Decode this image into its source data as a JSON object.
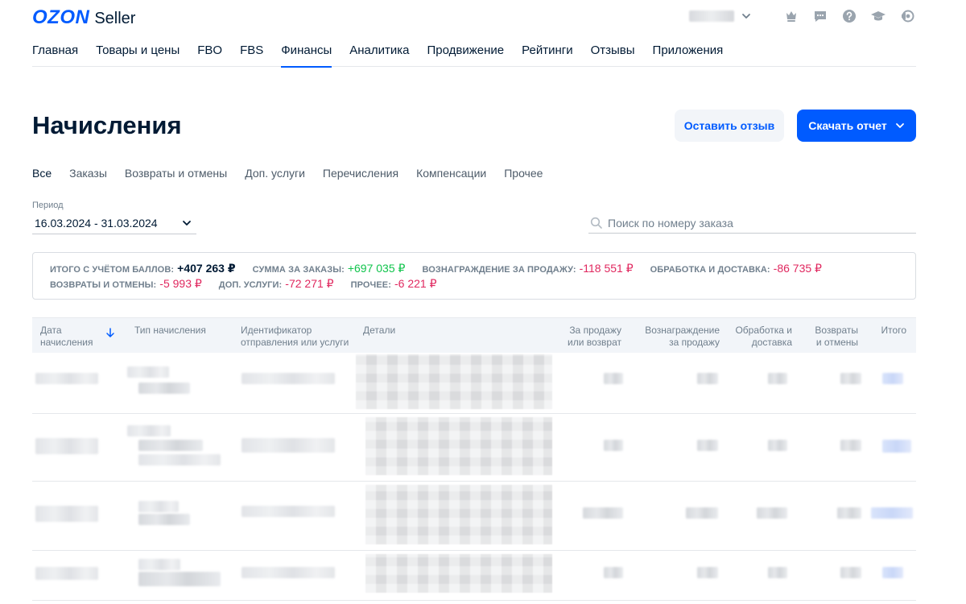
{
  "header": {
    "logo_brand": "OZON",
    "logo_product": "Seller",
    "icons": [
      "crown-icon",
      "chat-icon",
      "help-icon",
      "graduation-cap-icon",
      "megaphone-icon"
    ]
  },
  "nav": {
    "items": [
      {
        "label": "Главная",
        "active": false
      },
      {
        "label": "Товары и цены",
        "active": false
      },
      {
        "label": "FBO",
        "active": false
      },
      {
        "label": "FBS",
        "active": false
      },
      {
        "label": "Финансы",
        "active": true
      },
      {
        "label": "Аналитика",
        "active": false
      },
      {
        "label": "Продвижение",
        "active": false
      },
      {
        "label": "Рейтинги",
        "active": false
      },
      {
        "label": "Отзывы",
        "active": false
      },
      {
        "label": "Приложения",
        "active": false
      }
    ]
  },
  "page": {
    "title": "Начисления",
    "feedback_button": "Оставить отзыв",
    "report_button": "Скачать отчет"
  },
  "subtabs": {
    "items": [
      {
        "label": "Все",
        "active": true
      },
      {
        "label": "Заказы",
        "active": false
      },
      {
        "label": "Возвраты и отмены",
        "active": false
      },
      {
        "label": "Доп. услуги",
        "active": false
      },
      {
        "label": "Перечисления",
        "active": false
      },
      {
        "label": "Компенсации",
        "active": false
      },
      {
        "label": "Прочее",
        "active": false
      }
    ]
  },
  "period": {
    "label": "Период",
    "value": "16.03.2024 - 31.03.2024"
  },
  "search": {
    "placeholder": "Поиск по номеру заказа",
    "value": ""
  },
  "summary": {
    "row1": [
      {
        "label": "ИТОГО С УЧЁТОМ БАЛЛОВ:",
        "value": "+407 263 ₽",
        "kind": "total"
      },
      {
        "label": "СУММА ЗА ЗАКАЗЫ:",
        "value": "+697 035 ₽",
        "kind": "pos"
      },
      {
        "label": "ВОЗНАГРАЖДЕНИЕ ЗА ПРОДАЖУ:",
        "value": "-118 551 ₽",
        "kind": "neg"
      },
      {
        "label": "ОБРАБОТКА И ДОСТАВКА:",
        "value": "-86 735 ₽",
        "kind": "neg"
      }
    ],
    "row2": [
      {
        "label": "ВОЗВРАТЫ И ОТМЕНЫ:",
        "value": "-5 993 ₽",
        "kind": "neg"
      },
      {
        "label": "ДОП. УСЛУГИ:",
        "value": "-72 271 ₽",
        "kind": "neg"
      },
      {
        "label": "ПРОЧЕЕ:",
        "value": "-6 221 ₽",
        "kind": "neg"
      }
    ]
  },
  "table": {
    "columns": {
      "date": "Дата начисления",
      "type": "Тип начисления",
      "id": "Идентификатор отправления или услуги",
      "details": "Детали",
      "sale": "За продажу или возврат",
      "reward": "Вознаграждение за продажу",
      "delivery": "Обработка и доставка",
      "returns": "Возвраты и отмены",
      "total": "Итого"
    }
  },
  "colors": {
    "accent": "#005bff",
    "positive": "#10c44c",
    "negative": "#e0285f",
    "text": "#001a34",
    "muted": "#707f8d"
  }
}
